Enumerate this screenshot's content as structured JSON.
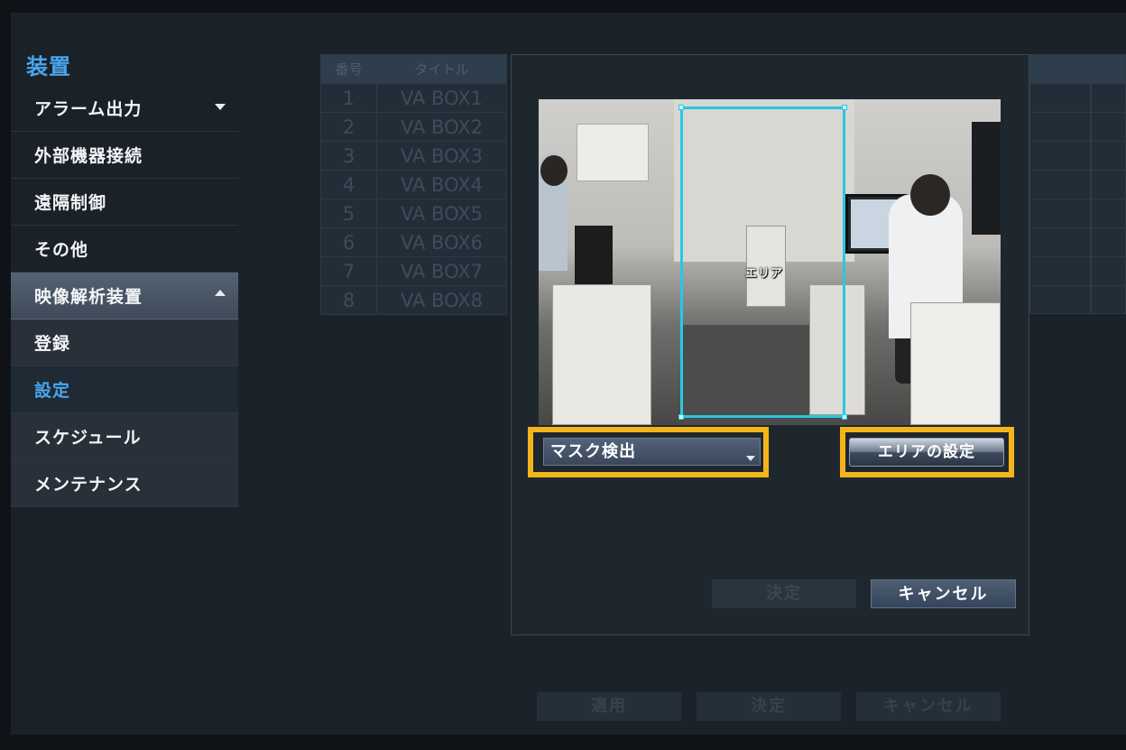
{
  "sidebar": {
    "title": "装置",
    "items": [
      {
        "label": "アラーム出力"
      },
      {
        "label": "外部機器接続"
      },
      {
        "label": "遠隔制御"
      },
      {
        "label": "その他"
      },
      {
        "label": "映像解析装置"
      },
      {
        "label": "登録"
      },
      {
        "label": "設定"
      },
      {
        "label": "スケジュール"
      },
      {
        "label": "メンテナンス"
      }
    ]
  },
  "table": {
    "headers": [
      "番号",
      "タイトル"
    ],
    "rows": [
      {
        "no": "1",
        "title": "VA BOX1"
      },
      {
        "no": "2",
        "title": "VA BOX2"
      },
      {
        "no": "3",
        "title": "VA BOX3"
      },
      {
        "no": "4",
        "title": "VA BOX4"
      },
      {
        "no": "5",
        "title": "VA BOX5"
      },
      {
        "no": "6",
        "title": "VA BOX6"
      },
      {
        "no": "7",
        "title": "VA BOX7"
      },
      {
        "no": "8",
        "title": "VA BOX8"
      }
    ]
  },
  "modal": {
    "area_label": "エリア",
    "detection_select": "マスク検出",
    "area_setting_button": "エリアの設定",
    "ok_button": "決定",
    "cancel_button": "キャンセル"
  },
  "bottom": {
    "apply": "適用",
    "ok": "決定",
    "cancel": "キャンセル"
  },
  "colors": {
    "accent": "#4aa6ee",
    "area_outline": "#27c8e6",
    "highlight": "#f5b51a"
  }
}
